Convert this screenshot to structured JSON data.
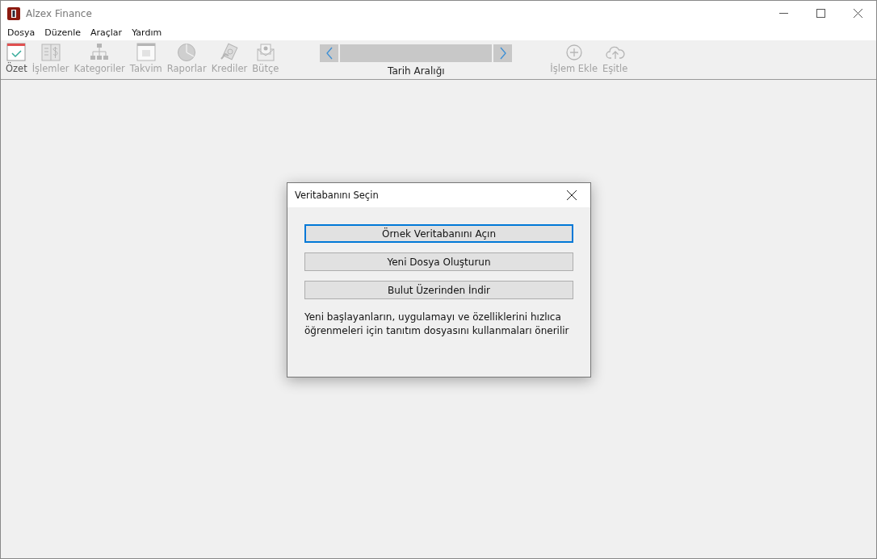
{
  "window": {
    "title": "Alzex Finance"
  },
  "menu": [
    "Dosya",
    "Düzenle",
    "Araçlar",
    "Yardım"
  ],
  "toolbar_left": [
    {
      "kind": "calendar-check",
      "label": "Özet",
      "disabled": false
    },
    {
      "kind": "ledger",
      "label": "İşlemler",
      "disabled": true
    },
    {
      "kind": "hierarchy",
      "label": "Kategoriler",
      "disabled": true
    },
    {
      "kind": "calendar",
      "label": "Takvim",
      "disabled": true
    },
    {
      "kind": "pie",
      "label": "Raporlar",
      "disabled": true
    },
    {
      "kind": "money",
      "label": "Krediler",
      "disabled": true
    },
    {
      "kind": "envelope",
      "label": "Bütçe",
      "disabled": true
    }
  ],
  "date_range": {
    "label": "Tarih Aralığı"
  },
  "toolbar_right": [
    {
      "kind": "plus",
      "label": "İşlem Ekle",
      "disabled": true
    },
    {
      "kind": "cloud",
      "label": "Eşitle",
      "disabled": true
    }
  ],
  "dialog": {
    "title": "Veritabanını Seçin",
    "buttons": [
      {
        "label": "Örnek Veritabanını Açın",
        "focused": true
      },
      {
        "label": "Yeni Dosya Oluşturun",
        "focused": false
      },
      {
        "label": "Bulut Üzerinden İndir",
        "focused": false
      }
    ],
    "note": "Yeni başlayanların, uygulamayı ve özelliklerini hızlıca öğrenmeleri için tanıtım dosyasını kullanmaları önerilir"
  }
}
